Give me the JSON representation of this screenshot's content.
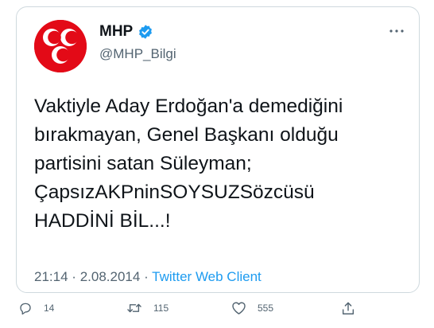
{
  "author": {
    "display_name": "MHP",
    "handle": "@MHP_Bilgi",
    "verified": true
  },
  "tweet": {
    "text": "Vaktiyle Aday Erdoğan'a demediğini\nbırakmayan, Genel Başkanı olduğu\npartisini satan Süleyman;\nÇapsızAKPninSOYSUZSözcüsü\nHADDİNİ BİL...!",
    "time": "21:14",
    "date": "2.08.2014",
    "separator": "·",
    "source": "Twitter Web Client"
  },
  "stats": {
    "replies": "14",
    "retweets": "115",
    "likes": "555"
  },
  "icons": {
    "more": "more-horizontal-icon",
    "reply": "reply-icon",
    "retweet": "retweet-icon",
    "like": "heart-icon",
    "share": "share-icon",
    "verified": "verified-badge-icon"
  },
  "colors": {
    "brand_red": "#e30a17",
    "link_blue": "#1d9bf0",
    "secondary_text": "#536471",
    "border": "#cfd9de"
  }
}
